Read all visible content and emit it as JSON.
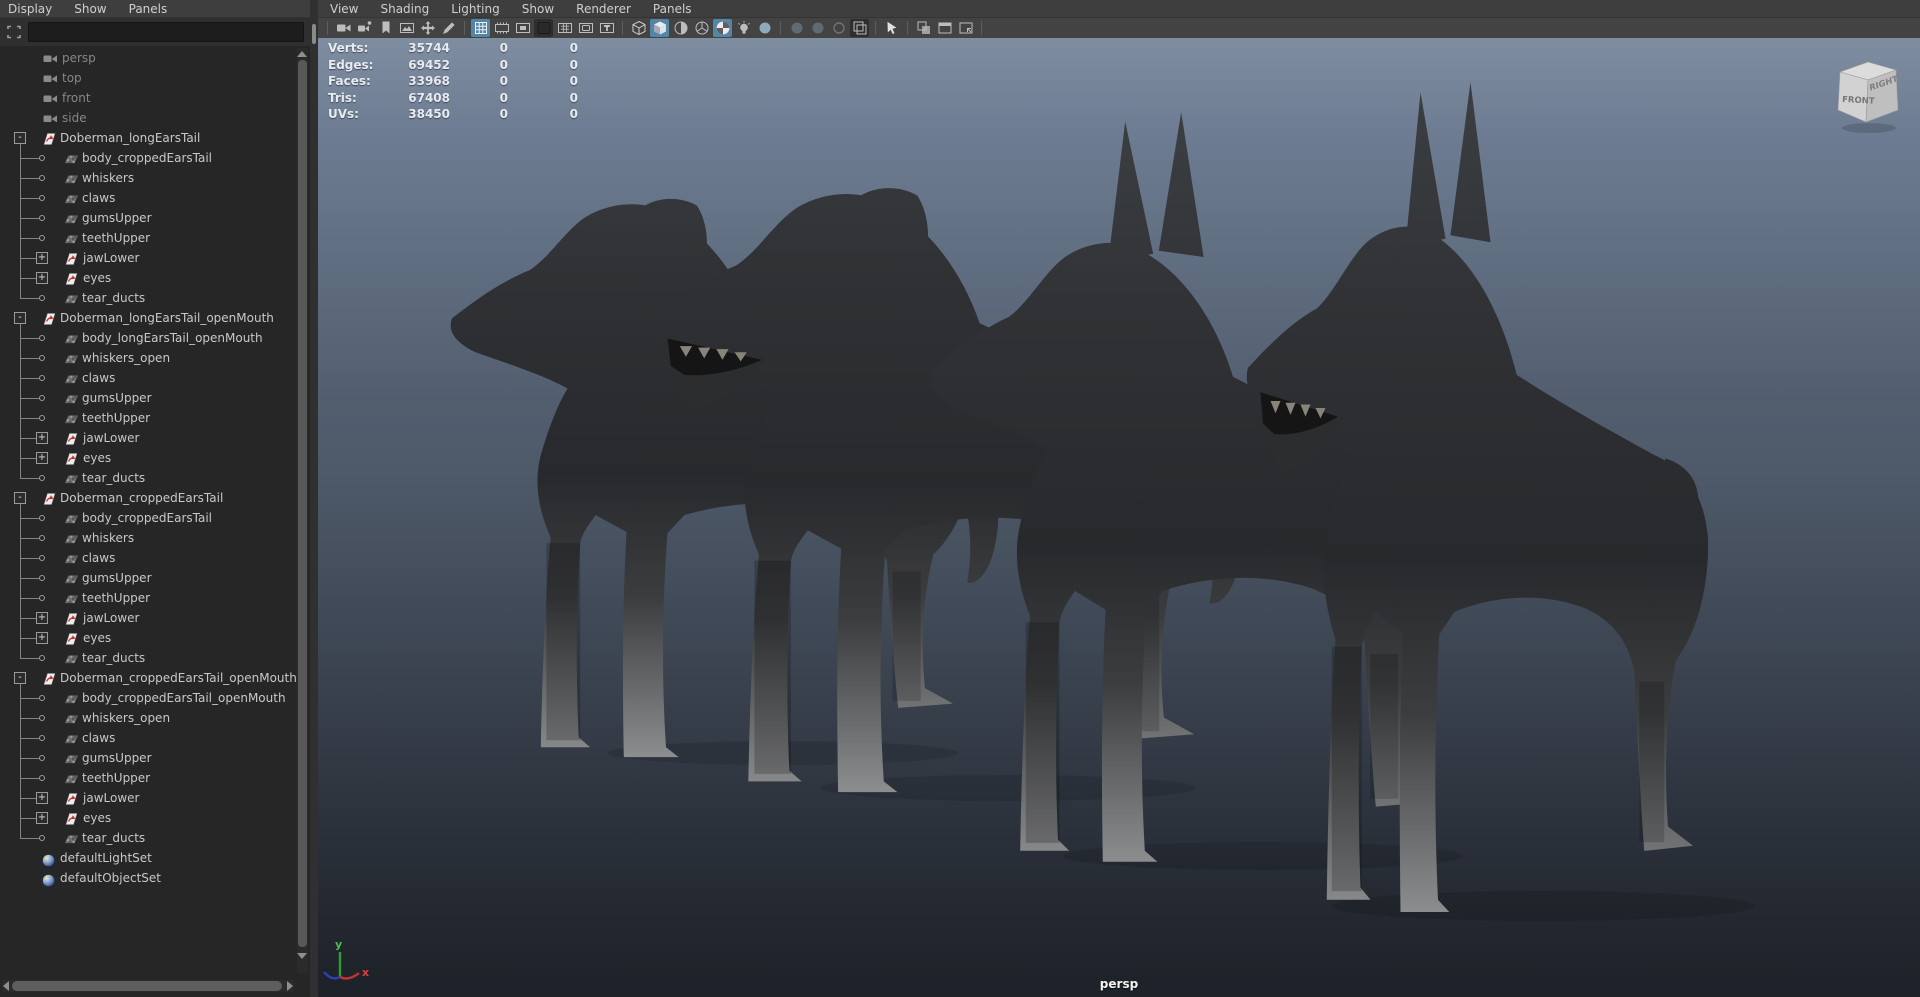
{
  "outliner": {
    "menus": [
      {
        "label": "Display"
      },
      {
        "label": "Show"
      },
      {
        "label": "Panels"
      }
    ],
    "search_placeholder": "",
    "tree": [
      {
        "type": "camera",
        "label": "persp"
      },
      {
        "type": "camera",
        "label": "top"
      },
      {
        "type": "camera",
        "label": "front"
      },
      {
        "type": "camera",
        "label": "side"
      },
      {
        "type": "group",
        "label": "Doberman_longEarsTail",
        "expander": "-"
      },
      {
        "type": "mesh",
        "label": "body_croppedEarsTail"
      },
      {
        "type": "mesh",
        "label": "whiskers"
      },
      {
        "type": "mesh",
        "label": "claws"
      },
      {
        "type": "mesh",
        "label": "gumsUpper"
      },
      {
        "type": "mesh",
        "label": "teethUpper"
      },
      {
        "type": "subgroup",
        "label": "jawLower",
        "expander": "+"
      },
      {
        "type": "subgroup",
        "label": "eyes",
        "expander": "+"
      },
      {
        "type": "mesh",
        "label": "tear_ducts",
        "last": true
      },
      {
        "type": "group",
        "label": "Doberman_longEarsTail_openMouth",
        "expander": "-"
      },
      {
        "type": "mesh",
        "label": "body_longEarsTail_openMouth"
      },
      {
        "type": "mesh",
        "label": "whiskers_open"
      },
      {
        "type": "mesh",
        "label": "claws"
      },
      {
        "type": "mesh",
        "label": "gumsUpper"
      },
      {
        "type": "mesh",
        "label": "teethUpper"
      },
      {
        "type": "subgroup",
        "label": "jawLower",
        "expander": "+"
      },
      {
        "type": "subgroup",
        "label": "eyes",
        "expander": "+"
      },
      {
        "type": "mesh",
        "label": "tear_ducts",
        "last": true
      },
      {
        "type": "group",
        "label": "Doberman_croppedEarsTail",
        "expander": "-"
      },
      {
        "type": "mesh",
        "label": "body_croppedEarsTail"
      },
      {
        "type": "mesh",
        "label": "whiskers"
      },
      {
        "type": "mesh",
        "label": "claws"
      },
      {
        "type": "mesh",
        "label": "gumsUpper"
      },
      {
        "type": "mesh",
        "label": "teethUpper"
      },
      {
        "type": "subgroup",
        "label": "jawLower",
        "expander": "+"
      },
      {
        "type": "subgroup",
        "label": "eyes",
        "expander": "+"
      },
      {
        "type": "mesh",
        "label": "tear_ducts",
        "last": true
      },
      {
        "type": "group",
        "label": "Doberman_croppedEarsTail_openMouth",
        "expander": "-"
      },
      {
        "type": "mesh",
        "label": "body_croppedEarsTail_openMouth"
      },
      {
        "type": "mesh",
        "label": "whiskers_open"
      },
      {
        "type": "mesh",
        "label": "claws"
      },
      {
        "type": "mesh",
        "label": "gumsUpper"
      },
      {
        "type": "mesh",
        "label": "teethUpper"
      },
      {
        "type": "subgroup",
        "label": "jawLower",
        "expander": "+"
      },
      {
        "type": "subgroup",
        "label": "eyes",
        "expander": "+"
      },
      {
        "type": "mesh",
        "label": "tear_ducts",
        "last": true
      },
      {
        "type": "set",
        "label": "defaultLightSet"
      },
      {
        "type": "set",
        "label": "defaultObjectSet"
      }
    ]
  },
  "viewport": {
    "menus": [
      {
        "label": "View"
      },
      {
        "label": "Shading"
      },
      {
        "label": "Lighting"
      },
      {
        "label": "Show"
      },
      {
        "label": "Renderer"
      },
      {
        "label": "Panels"
      }
    ],
    "toolbar": [
      {
        "divider": true
      },
      {
        "name": "select-camera-icon",
        "glyph": "cam",
        "state": "normal"
      },
      {
        "name": "camera-attributes-icon",
        "glyph": "cam2",
        "state": "normal"
      },
      {
        "name": "bookmark-icon",
        "glyph": "flag",
        "state": "normal"
      },
      {
        "name": "image-plane-icon",
        "glyph": "img",
        "state": "normal"
      },
      {
        "name": "two-d-pan-zoom-icon",
        "glyph": "pan",
        "state": "normal"
      },
      {
        "name": "grease-pencil-icon",
        "glyph": "pencil",
        "state": "normal"
      },
      {
        "divider": true
      },
      {
        "name": "grid-icon",
        "glyph": "grid",
        "state": "active"
      },
      {
        "name": "film-gate-icon",
        "glyph": "film",
        "state": "normal"
      },
      {
        "name": "resolution-gate-icon",
        "glyph": "res",
        "state": "normal"
      },
      {
        "name": "gate-mask-icon",
        "glyph": "mask",
        "state": "pressed"
      },
      {
        "name": "field-chart-icon",
        "glyph": "field",
        "state": "normal"
      },
      {
        "name": "safe-action-icon",
        "glyph": "safeact",
        "state": "normal"
      },
      {
        "name": "safe-title-icon",
        "glyph": "T",
        "state": "normal"
      },
      {
        "divider": true
      },
      {
        "name": "wireframe-icon",
        "glyph": "cube",
        "state": "normal"
      },
      {
        "name": "smooth-shade-icon",
        "glyph": "cubeS",
        "state": "active"
      },
      {
        "name": "textured-icon",
        "glyph": "half",
        "state": "normal"
      },
      {
        "name": "use-all-lights-icon",
        "glyph": "hex",
        "state": "normal"
      },
      {
        "name": "shadows-icon",
        "glyph": "checker",
        "state": "active"
      },
      {
        "name": "occlusion-icon",
        "glyph": "bulb",
        "state": "normal"
      },
      {
        "name": "motion-blur-icon",
        "glyph": "ball",
        "state": "normal"
      },
      {
        "divider": true
      },
      {
        "name": "exposure-icon",
        "glyph": "ball",
        "state": "disabled"
      },
      {
        "name": "gamma-icon",
        "glyph": "ball",
        "state": "disabled"
      },
      {
        "name": "view-transform-icon",
        "glyph": "ring",
        "state": "disabled"
      },
      {
        "name": "color-management-icon",
        "glyph": "crop",
        "state": "pressed"
      },
      {
        "divider": true
      },
      {
        "name": "object-selection-icon",
        "glyph": "cursor",
        "state": "normal"
      },
      {
        "divider": true
      },
      {
        "name": "tear-off-copy-icon",
        "glyph": "win",
        "state": "normal"
      },
      {
        "name": "tear-off-icon",
        "glyph": "win2",
        "state": "normal"
      },
      {
        "name": "snapshot-icon",
        "glyph": "win3",
        "state": "normal"
      },
      {
        "divider": true
      }
    ],
    "hud": {
      "rows": [
        {
          "label": "Verts:",
          "c1": "35744",
          "c2": "0",
          "c3": "0"
        },
        {
          "label": "Edges:",
          "c1": "69452",
          "c2": "0",
          "c3": "0"
        },
        {
          "label": "Faces:",
          "c1": "33968",
          "c2": "0",
          "c3": "0"
        },
        {
          "label": "Tris:",
          "c1": "67408",
          "c2": "0",
          "c3": "0"
        },
        {
          "label": "UVs:",
          "c1": "38450",
          "c2": "0",
          "c3": "0"
        }
      ]
    },
    "camera_label": "persp",
    "view_cube": {
      "front_label": "FRONT",
      "right_label": "RIGHT"
    },
    "axis": {
      "x_label": "x",
      "y_label": "y"
    },
    "colors": {
      "accent_active": "#5285a6",
      "gradient_top": "#7f8da1",
      "gradient_bottom": "#1d2128",
      "model_dark": "#2a2b2e",
      "model_leg_light": "#909192"
    }
  }
}
